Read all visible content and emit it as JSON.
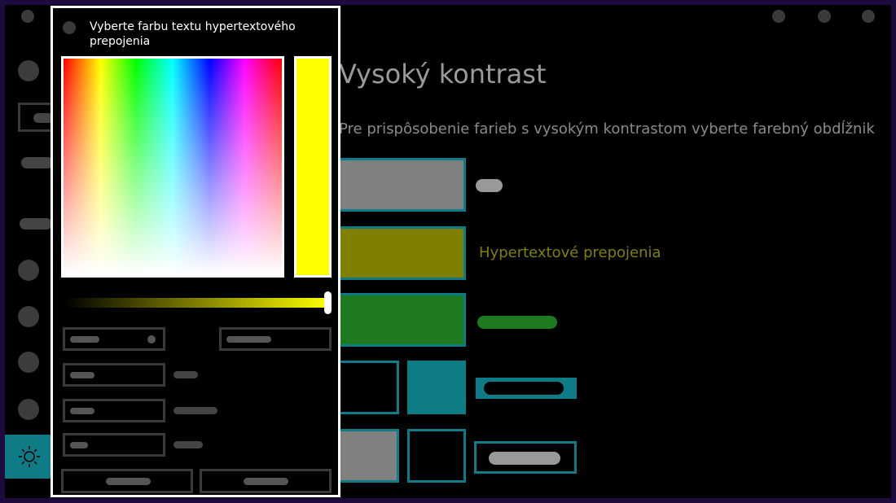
{
  "settings": {
    "title": "Vysoký kontrast",
    "description": "Pre prispôsobenie farieb s vysokým kontrastom vyberte farebný obdĺžnik",
    "hyperlink_label": "Hypertextové prepojenia"
  },
  "colors": {
    "accent": "#0e7c86",
    "text_swatch": "#808080",
    "hyperlink_swatch": "#808000",
    "disabled_swatch": "#1f7a1f",
    "selected_background": "#0e7c86",
    "button_swatch": "#808080",
    "dialog_selected": "#ffff00"
  },
  "dialog": {
    "title": "Vyberte farbu textu hypertextového prepojenia",
    "brightness": 1.0
  },
  "icons": {
    "sidebar_active": "sun-icon"
  }
}
